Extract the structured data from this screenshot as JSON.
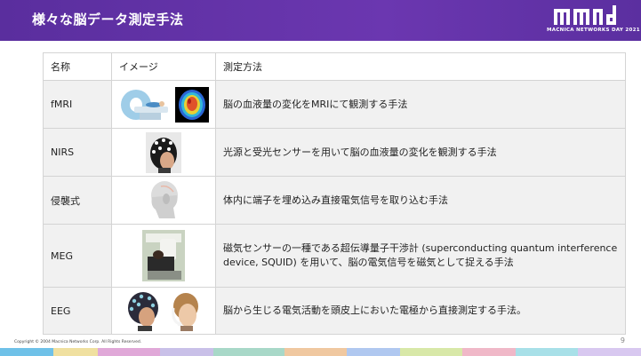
{
  "slide": {
    "title": "様々な脳データ測定手法",
    "logo_text": "MACNICA NETWORKS DAY 2021",
    "copyright": "Copyright © 2004 Macnica Networks Corp. All Rights Reserved.",
    "page_number": "9"
  },
  "table": {
    "headers": [
      "名称",
      "イメージ",
      "測定方法"
    ],
    "rows": [
      {
        "name": "fMRI",
        "description": "脳の血液量の変化をMRIにて観測する手法",
        "image_icons": [
          "mri-scanner-icon",
          "brain-scan-icon"
        ]
      },
      {
        "name": "NIRS",
        "description": "光源と受光センサーを用いて脳の血液量の変化を観測する手法",
        "image_icons": [
          "nirs-headcap-icon"
        ]
      },
      {
        "name": "侵襲式",
        "description": "体内に端子を埋め込み直接電気信号を取り込む手法",
        "image_icons": [
          "head-model-icon"
        ]
      },
      {
        "name": "MEG",
        "description": "磁気センサーの一種である超伝導量子干渉計 (superconducting quantum interference device, SQUID) を用いて、脳の電気信号を磁気として捉える手法",
        "image_icons": [
          "meg-device-icon"
        ]
      },
      {
        "name": "EEG",
        "description": "脳から生じる電気活動を頭皮上においた電極から直接測定する手法。",
        "image_icons": [
          "eeg-cap-icon",
          "eeg-headset-icon"
        ]
      }
    ]
  },
  "colors": {
    "header_bg": "#5a2e9e",
    "row_bg": "#f1f1f1",
    "border": "#d4d4d4"
  }
}
